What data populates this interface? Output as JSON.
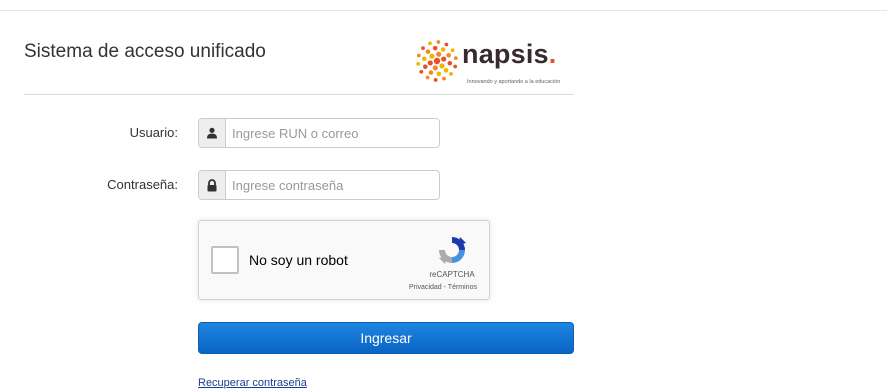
{
  "header": {
    "title": "Sistema de acceso unificado",
    "logo": {
      "word": "napsis",
      "dot": ".",
      "tagline": "Innovando y aportando a la educación",
      "colors": {
        "text": "#3a2a2f",
        "accent": "#e6512b",
        "yellow": "#f4b400"
      }
    }
  },
  "form": {
    "username": {
      "label": "Usuario:",
      "placeholder": "Ingrese RUN o correo",
      "value": "",
      "icon": "user-icon"
    },
    "password": {
      "label": "Contraseña:",
      "placeholder": "Ingrese contraseña",
      "value": "",
      "icon": "lock-icon"
    },
    "recaptcha": {
      "label": "No soy un robot",
      "brand": "reCAPTCHA",
      "privacy": "Privacidad",
      "separator": " - ",
      "terms": "Términos",
      "checked": false
    },
    "submit_label": "Ingresar",
    "recover_label": "Recuperar contraseña"
  },
  "colors": {
    "primary_button": "#1578d6",
    "link": "#1a3d8f"
  }
}
